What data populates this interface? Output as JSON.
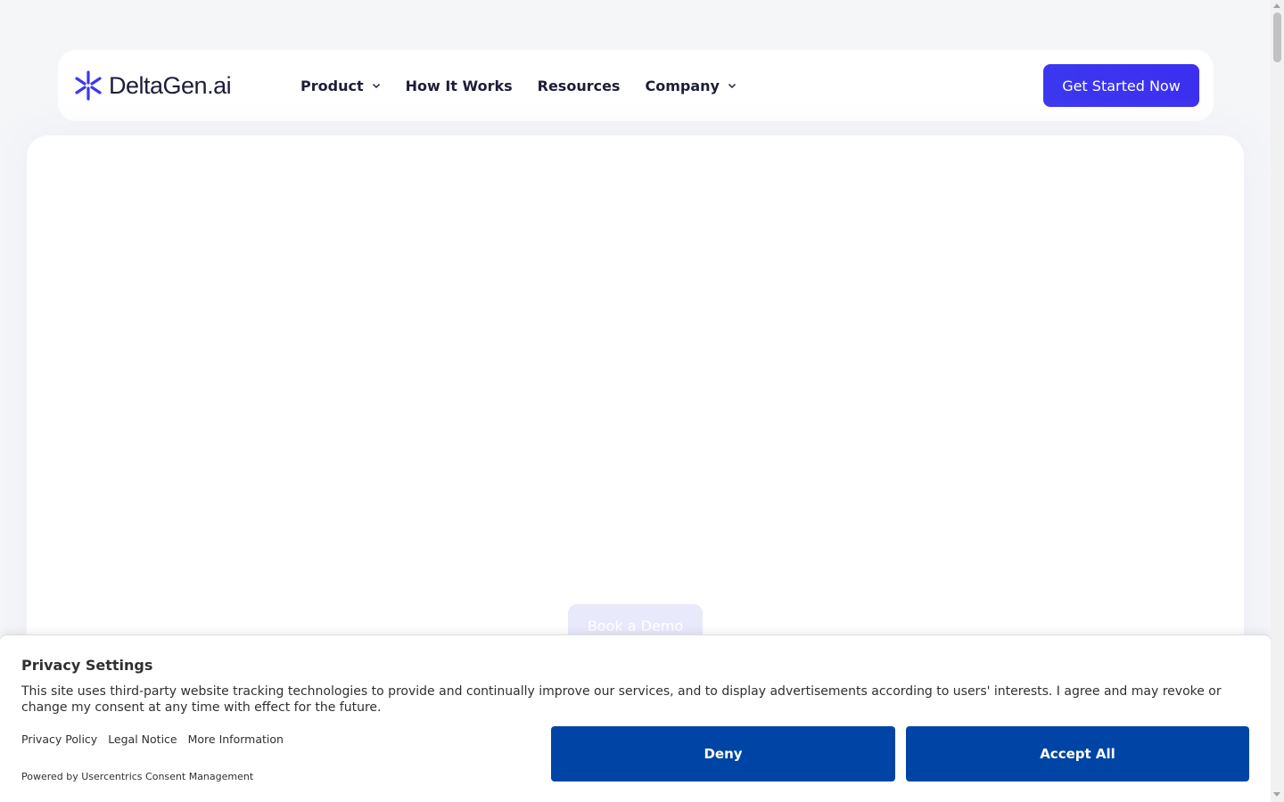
{
  "nav": {
    "logo_text": "DeltaGen.ai",
    "items": [
      {
        "label": "Product",
        "has_dropdown": true
      },
      {
        "label": "How It Works",
        "has_dropdown": false
      },
      {
        "label": "Resources",
        "has_dropdown": false
      },
      {
        "label": "Company",
        "has_dropdown": true
      }
    ],
    "cta_label": "Get Started Now"
  },
  "hero": {
    "demo_button_label": "Book a Demo"
  },
  "consent": {
    "title": "Privacy Settings",
    "description": "This site uses third-party website tracking technologies to provide and continually improve our services, and to display advertisements according to users' interests. I agree and may revoke or change my consent at any time with effect for the future.",
    "links": [
      "Privacy Policy",
      "Legal Notice",
      "More Information"
    ],
    "powered_by": "Powered by Usercentrics Consent Management",
    "deny_label": "Deny",
    "accept_label": "Accept All"
  },
  "colors": {
    "brand_primary": "#3b37f0",
    "consent_button": "#0045a5",
    "page_background": "#f5f6f8"
  }
}
